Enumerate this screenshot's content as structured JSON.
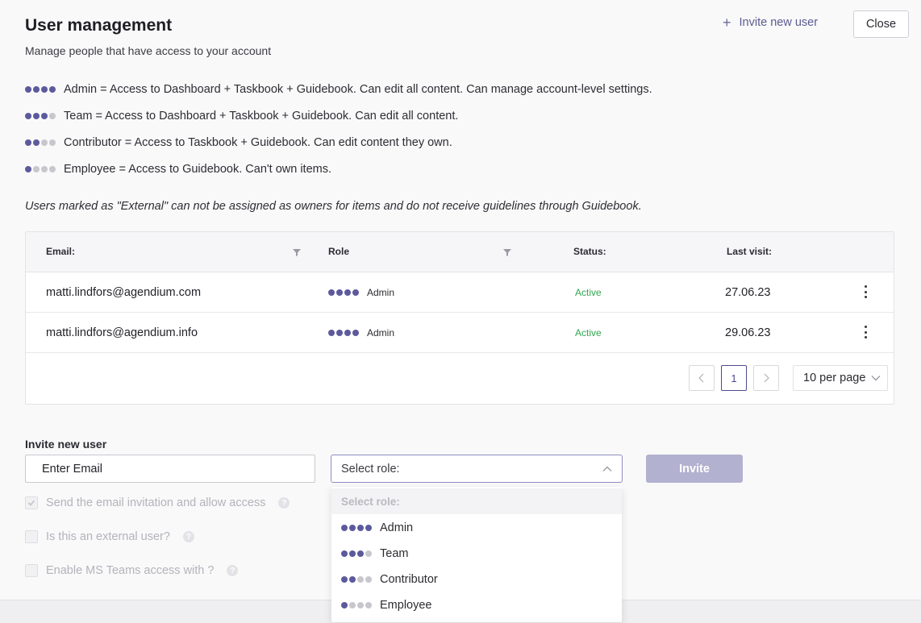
{
  "header": {
    "title": "User management",
    "subtitle": "Manage people that have access to your account",
    "invite_link": "Invite new user",
    "close_label": "Close"
  },
  "roles_legend": [
    {
      "level": 4,
      "text": "Admin = Access to Dashboard + Taskbook + Guidebook. Can edit all content. Can manage account-level settings."
    },
    {
      "level": 3,
      "text": "Team = Access to Dashboard + Taskbook + Guidebook. Can edit all content."
    },
    {
      "level": 2,
      "text": "Contributor = Access to Taskbook + Guidebook. Can edit content they own."
    },
    {
      "level": 1,
      "text": "Employee = Access to Guidebook. Can't own items."
    }
  ],
  "external_note": "Users marked as \"External\" can not be assigned as owners for items and do not receive guidelines through Guidebook.",
  "table": {
    "columns": {
      "email": "Email:",
      "role": "Role",
      "status": "Status:",
      "last_visit": "Last visit:"
    },
    "rows": [
      {
        "email": "matti.lindfors@agendium.com",
        "role": "Admin",
        "role_level": 4,
        "status": "Active",
        "last_visit": "27.06.23"
      },
      {
        "email": "matti.lindfors@agendium.info",
        "role": "Admin",
        "role_level": 4,
        "status": "Active",
        "last_visit": "29.06.23"
      }
    ],
    "pagination": {
      "current_page": "1",
      "per_page": "10 per page"
    }
  },
  "invite_form": {
    "label": "Invite new user",
    "email_placeholder": "Enter Email",
    "role_placeholder": "Select role:",
    "invite_button": "Invite",
    "options": {
      "send_invitation": "Send the email invitation and allow access",
      "external_user": "Is this an external user?",
      "ms_teams": "Enable MS Teams access with ?"
    },
    "dropdown": {
      "header": "Select role:",
      "items": [
        {
          "label": "Admin",
          "level": 4
        },
        {
          "label": "Team",
          "level": 3
        },
        {
          "label": "Contributor",
          "level": 2
        },
        {
          "label": "Employee",
          "level": 1
        }
      ]
    }
  },
  "colors": {
    "accent": "#5c5a9c",
    "dot_inactive": "#c7c7cd",
    "status_active": "#2fa84f",
    "invite_button_disabled": "#b2b1cf"
  }
}
